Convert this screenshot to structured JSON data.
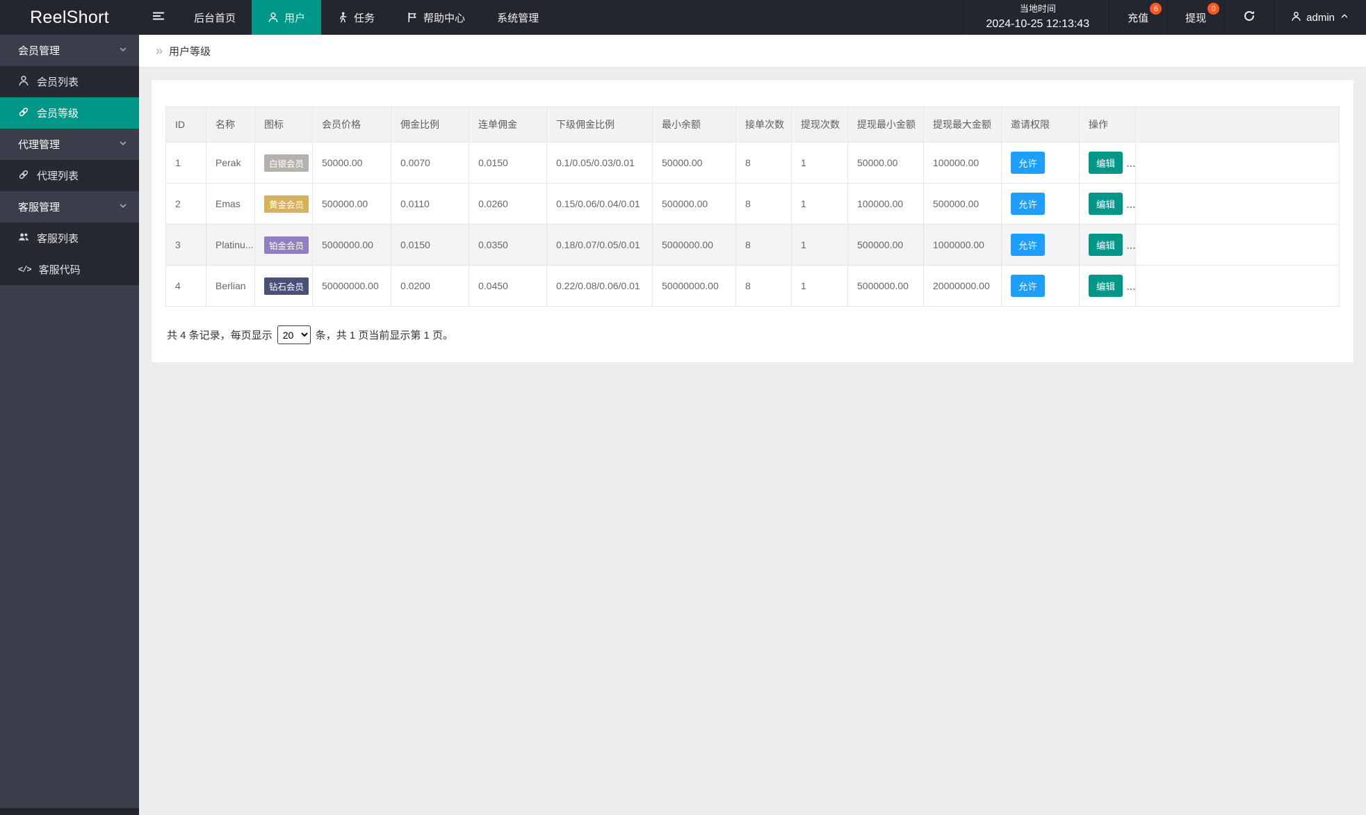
{
  "colors": {
    "accent_teal": "#009688",
    "button_blue": "#1E9FFF",
    "badge_orange": "#FF5722"
  },
  "topbar": {
    "logo": "ReelShort",
    "nav": [
      {
        "label": "后台首页"
      },
      {
        "label": "用户",
        "icon": "user-icon",
        "active": true
      },
      {
        "label": "任务",
        "icon": "walking-person-icon"
      },
      {
        "label": "帮助中心",
        "icon": "flag-icon"
      },
      {
        "label": "系统管理"
      }
    ],
    "time": {
      "label": "当地时间",
      "value": "2024-10-25 12:13:43"
    },
    "recharge": {
      "label": "充值",
      "badge": "6"
    },
    "withdraw": {
      "label": "提现",
      "badge": "0"
    },
    "admin": {
      "label": "admin"
    }
  },
  "sidebar": {
    "groups": [
      {
        "label": "会员管理",
        "children": [
          {
            "label": "会员列表",
            "icon": "user-icon"
          },
          {
            "label": "会员等级",
            "icon": "link-icon",
            "active": true
          }
        ]
      },
      {
        "label": "代理管理",
        "children": [
          {
            "label": "代理列表",
            "icon": "link-icon"
          }
        ]
      },
      {
        "label": "客服管理",
        "children": [
          {
            "label": "客服列表",
            "icon": "users-icon"
          },
          {
            "label": "客服代码",
            "icon": "code-icon"
          }
        ]
      }
    ]
  },
  "breadcrumb": {
    "label": "用户等级"
  },
  "table": {
    "columns": [
      "ID",
      "名称",
      "图标",
      "会员价格",
      "佣金比例",
      "连单佣金",
      "下级佣金比例",
      "最小余额",
      "接单次数",
      "提现次数",
      "提现最小金额",
      "提现最大金额",
      "邀请权限",
      "操作"
    ],
    "rows": [
      {
        "id": "1",
        "name": "Perak",
        "badge": "白银会员",
        "badge_bg": "#B5B2AD",
        "price": "50000.00",
        "rate": "0.0070",
        "chain": "0.0150",
        "sub_rates": "0.1/0.05/0.03/0.01",
        "min_balance": "50000.00",
        "orders": "8",
        "withdraws": "1",
        "min_withdraw": "50000.00",
        "max_withdraw": "100000.00",
        "invite": "允许",
        "edit": "编辑",
        "more": "…"
      },
      {
        "id": "2",
        "name": "Emas",
        "badge": "黄金会员",
        "badge_bg": "#D9B05E",
        "price": "500000.00",
        "rate": "0.0110",
        "chain": "0.0260",
        "sub_rates": "0.15/0.06/0.04/0.01",
        "min_balance": "500000.00",
        "orders": "8",
        "withdraws": "1",
        "min_withdraw": "100000.00",
        "max_withdraw": "500000.00",
        "invite": "允许",
        "edit": "编辑",
        "more": "…"
      },
      {
        "id": "3",
        "name": "Platinu...",
        "badge": "铂金会员",
        "badge_bg": "#917FC0",
        "price": "5000000.00",
        "rate": "0.0150",
        "chain": "0.0350",
        "sub_rates": "0.18/0.07/0.05/0.01",
        "min_balance": "5000000.00",
        "orders": "8",
        "withdraws": "1",
        "min_withdraw": "500000.00",
        "max_withdraw": "1000000.00",
        "invite": "允许",
        "edit": "编辑",
        "more": "…"
      },
      {
        "id": "4",
        "name": "Berlian",
        "badge": "钻石会员",
        "badge_bg": "#495276",
        "price": "50000000.00",
        "rate": "0.0200",
        "chain": "0.0450",
        "sub_rates": "0.22/0.08/0.06/0.01",
        "min_balance": "50000000.00",
        "orders": "8",
        "withdraws": "1",
        "min_withdraw": "5000000.00",
        "max_withdraw": "20000000.00",
        "invite": "允许",
        "edit": "编辑",
        "more": "…"
      }
    ]
  },
  "pagination": {
    "prefix": "共 4 条记录，每页显示",
    "per_page": "20",
    "suffix": "条，共 1 页当前显示第 1 页。"
  }
}
